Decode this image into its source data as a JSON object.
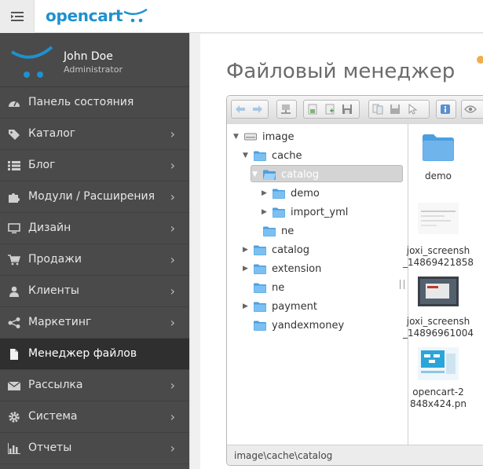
{
  "header": {
    "logo_text": "opencart"
  },
  "user": {
    "name": "John Doe",
    "role": "Administrator"
  },
  "nav": [
    {
      "label": "Панель состояния",
      "icon": "dashboard-icon",
      "has_children": false
    },
    {
      "label": "Каталог",
      "icon": "tag-icon",
      "has_children": true
    },
    {
      "label": "Блог",
      "icon": "list-icon",
      "has_children": true
    },
    {
      "label": "Модули / Расширения",
      "icon": "puzzle-icon",
      "has_children": true
    },
    {
      "label": "Дизайн",
      "icon": "monitor-icon",
      "has_children": true
    },
    {
      "label": "Продажи",
      "icon": "cart-icon",
      "has_children": true
    },
    {
      "label": "Клиенты",
      "icon": "user-icon",
      "has_children": true
    },
    {
      "label": "Маркетинг",
      "icon": "share-icon",
      "has_children": true
    },
    {
      "label": "Менеджер файлов",
      "icon": "file-icon",
      "has_children": false,
      "active": true
    },
    {
      "label": "Рассылка",
      "icon": "envelope-icon",
      "has_children": true
    },
    {
      "label": "Система",
      "icon": "cog-icon",
      "has_children": true
    },
    {
      "label": "Отчеты",
      "icon": "bar-chart-icon",
      "has_children": true
    }
  ],
  "page": {
    "title": "Файловый менеджер"
  },
  "file_manager": {
    "tree": [
      {
        "label": "image",
        "depth": 0,
        "arrow": "open",
        "icon": "drive-icon"
      },
      {
        "label": "cache",
        "depth": 1,
        "arrow": "open",
        "icon": "folder-icon"
      },
      {
        "label": "catalog",
        "depth": 2,
        "arrow": "open",
        "icon": "folder-open-icon",
        "selected": true
      },
      {
        "label": "demo",
        "depth": 3,
        "arrow": "closed",
        "icon": "folder-icon"
      },
      {
        "label": "import_yml",
        "depth": 3,
        "arrow": "closed",
        "icon": "folder-icon"
      },
      {
        "label": "ne",
        "depth": 2,
        "arrow": "none",
        "icon": "folder-icon"
      },
      {
        "label": "catalog",
        "depth": 1,
        "arrow": "closed",
        "icon": "folder-icon"
      },
      {
        "label": "extension",
        "depth": 1,
        "arrow": "closed",
        "icon": "folder-icon"
      },
      {
        "label": "ne",
        "depth": 1,
        "arrow": "none",
        "icon": "folder-icon"
      },
      {
        "label": "payment",
        "depth": 1,
        "arrow": "closed",
        "icon": "folder-icon"
      },
      {
        "label": "yandexmoney",
        "depth": 1,
        "arrow": "none",
        "icon": "folder-icon"
      }
    ],
    "files": [
      {
        "name_line1": "demo",
        "name_line2": "",
        "type": "folder"
      },
      {
        "name_line1": "joxi_screensh",
        "name_line2": "_14869421858",
        "type": "image-light"
      },
      {
        "name_line1": "joxi_screensh",
        "name_line2": "_14896961004",
        "type": "image-dark"
      },
      {
        "name_line1": "opencart-2",
        "name_line2": "848x424.pn",
        "type": "image-blue"
      }
    ],
    "status_path": "image\\cache\\catalog"
  },
  "colors": {
    "brand": "#1e91cf",
    "sidebar": "#4a4a4a",
    "folder": "#4b9fe0"
  }
}
